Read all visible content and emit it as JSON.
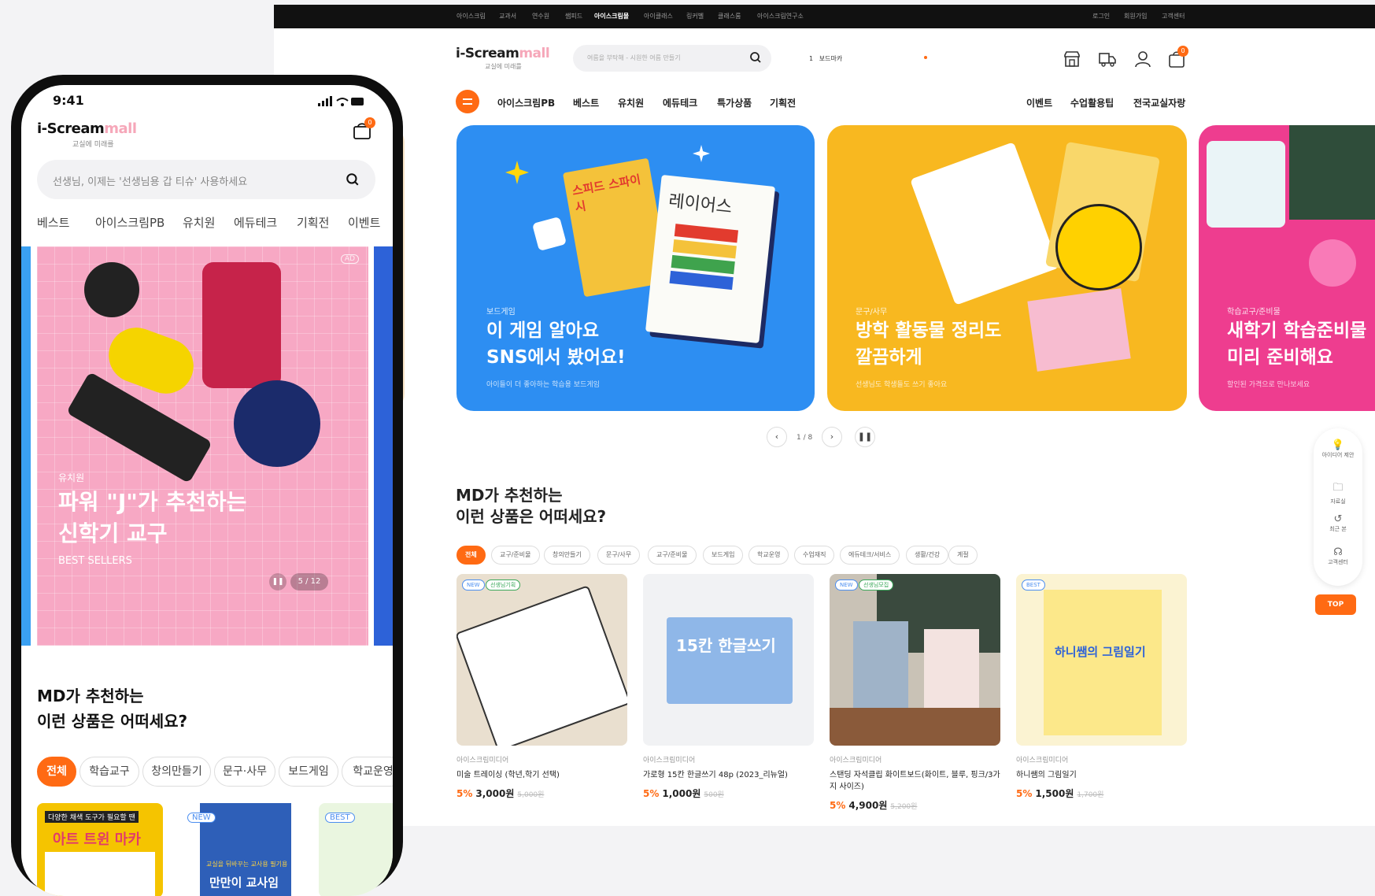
{
  "desktop": {
    "topbar": {
      "left_items": [
        "아이스크림",
        "교과서",
        "연수원",
        "쌤피드",
        "아이스크림몰",
        "아이클래스",
        "링커벨",
        "클래스룸",
        "아이스크림연구소"
      ],
      "active_item": "아이스크림몰",
      "right_items": [
        "로그인",
        "회원가입",
        "고객센터"
      ]
    },
    "logo": {
      "text_a": "i-Scream",
      "text_b": "mall",
      "sub": "교실에 미래를"
    },
    "search": {
      "placeholder": "여름을 부탁해 - 시원한 여름 만들기"
    },
    "ranking": {
      "rank": "1",
      "keyword": "보드마카"
    },
    "cart_count": "0",
    "nav": {
      "left": [
        "아이스크림PB",
        "베스트",
        "유치원",
        "에듀테크",
        "특가상품",
        "기획전"
      ],
      "right": [
        "이벤트",
        "수업활용팁",
        "전국교실자랑"
      ]
    },
    "banners": [
      {
        "category": "보드게임",
        "title_1": "이 게임 알아요",
        "title_2": "SNS에서 봤어요!",
        "sub": "아이들이 더 좋아하는 학습용 보드게임",
        "color": "#2d8ef2",
        "game_box": "레이어스",
        "game_box_2": "스피드 스파이시"
      },
      {
        "category": "문구/사무",
        "title_1": "방학 활동물 정리도",
        "title_2": "깔끔하게",
        "sub": "선생님도 학생들도 쓰기 좋아요",
        "color": "#f8b820"
      },
      {
        "category": "학습교구/준비물",
        "title_1": "새학기 학습준비물",
        "title_2": "미리 준비해요",
        "sub": "할인된 가격으로 만나보세요",
        "color": "#ee3d8f"
      }
    ],
    "pager": "1 / 8",
    "md": {
      "line1": "MD가 추천하는",
      "line2": "이런 상품은 어떠세요?"
    },
    "chips": [
      "전체",
      "교구/준비물",
      "창의만들기",
      "문구/사무",
      "교구/준비물",
      "보드게임",
      "학교운영",
      "수업재직",
      "에듀테크/서비스",
      "생활/건강",
      "계절"
    ],
    "products": [
      {
        "badges": [
          "NEW",
          "선생님기획"
        ],
        "brand": "아이스크림미디어",
        "name": "미술 트레이싱 (학년,학기 선택)",
        "discount": "5%",
        "price": "3,000원",
        "orig": "5,000원"
      },
      {
        "badges": [],
        "brand": "아이스크림미디어",
        "name": "가로형 15칸 한글쓰기 48p (2023_리뉴얼)",
        "discount": "5%",
        "price": "1,000원",
        "orig": "500원",
        "img_text": "15칸 한글쓰기"
      },
      {
        "badges": [
          "NEW",
          "선생님모집"
        ],
        "brand": "아이스크림미디어",
        "name": "스탠딩 자석클립 화이트보드(화이트, 블루, 핑크/3가지 사이즈)",
        "discount": "5%",
        "price": "4,900원",
        "orig": "5,200원"
      },
      {
        "badges": [
          "BEST"
        ],
        "brand": "아이스크림미디어",
        "name": "하니쌤의 그림일기",
        "discount": "5%",
        "price": "1,500원",
        "orig": "1,700원",
        "img_text": "하니쌤의 그림일기"
      }
    ],
    "floater": [
      "아이디어 제안",
      "자료실",
      "최근 본",
      "고객센터"
    ],
    "top_label": "TOP"
  },
  "phone": {
    "time": "9:41",
    "logo": {
      "text_a": "i-Scream",
      "text_b": "mall",
      "sub": "교실에 미래를"
    },
    "cart_count": "0",
    "search": {
      "placeholder": "선생님, 이제는 '선생님용 갑 티슈' 사용하세요"
    },
    "tabs": [
      "베스트",
      "아이스크림PB",
      "유치원",
      "에듀테크",
      "기획전",
      "이벤트"
    ],
    "banner": {
      "ad": "AD",
      "category": "유치원",
      "title_1": "파워 \"J\"가 추천하는",
      "title_2": "신학기 교구",
      "sub": "BEST SELLERS",
      "pager": "5 / 12"
    },
    "md": {
      "line1": "MD가 추천하는",
      "line2": "이런 상품은 어떠세요?"
    },
    "chips": [
      "전체",
      "학습교구",
      "창의만들기",
      "문구·사무",
      "보드게임",
      "학교운영"
    ],
    "products": [
      {
        "badges": [],
        "title": "아트 트윈 마카",
        "sub": "다양한 채색 도구가 필요할 땐"
      },
      {
        "badges": [
          "NEW"
        ],
        "title": "만만이 교사임",
        "sub": "교실을 뒤바꾸는 교사용 필기용"
      },
      {
        "badges": [
          "BEST"
        ],
        "title": "",
        "sub": ""
      }
    ]
  }
}
